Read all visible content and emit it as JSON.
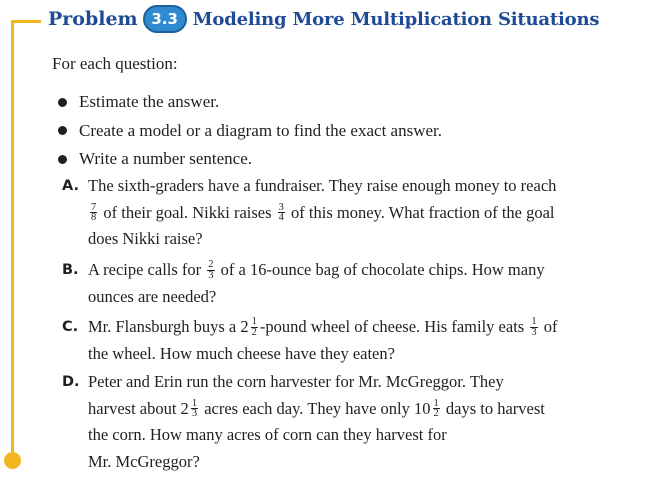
{
  "header": {
    "problem_word": "Problem",
    "number": "3.3",
    "title": "Modeling More Multiplication Situations"
  },
  "intro": "For each question:",
  "bullets": [
    "Estimate the answer.",
    "Create a model or a diagram to find the exact answer.",
    "Write a number sentence."
  ],
  "questions": [
    {
      "label": "A.",
      "t1": "The sixth-graders have a fundraiser. They raise enough money to reach",
      "f1": {
        "n": "7",
        "d": "8"
      },
      "t2": "of their goal. Nikki raises",
      "f2": {
        "n": "3",
        "d": "4"
      },
      "t3": "of this money. What fraction of the goal",
      "t4": "does Nikki raise?"
    },
    {
      "label": "B.",
      "t1": "A recipe calls for",
      "f1": {
        "n": "2",
        "d": "3"
      },
      "t2": "of a 16-ounce bag of chocolate chips. How many",
      "t3": "ounces are needed?"
    },
    {
      "label": "C.",
      "t1": "Mr. Flansburgh buys a 2",
      "f1": {
        "n": "1",
        "d": "2"
      },
      "t2": "-pound wheel of cheese. His family eats",
      "f2": {
        "n": "1",
        "d": "3"
      },
      "t3": "of",
      "t4": "the wheel. How much cheese have they eaten?"
    },
    {
      "label": "D.",
      "t1": "Peter and Erin run the corn harvester for Mr. McGreggor. They",
      "t2": "harvest about 2",
      "f1": {
        "n": "1",
        "d": "3"
      },
      "t3": "acres each day. They have only 10",
      "f2": {
        "n": "1",
        "d": "2"
      },
      "t4": "days to harvest",
      "t5": "the corn. How many acres of corn can they harvest for",
      "t6": "Mr. McGreggor?"
    }
  ]
}
